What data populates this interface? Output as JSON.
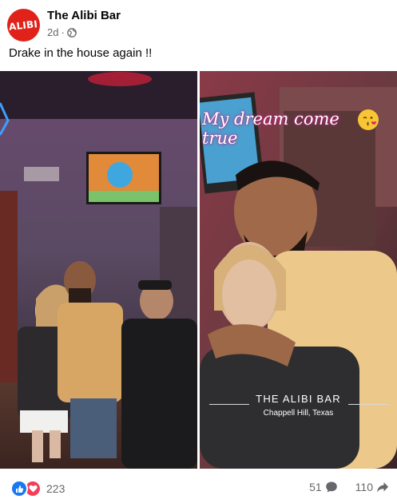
{
  "post": {
    "page_name": "The Alibi Bar",
    "avatar_text": "ALIBI",
    "time": "2d",
    "separator": "·",
    "caption": "Drake in the house again !!"
  },
  "photo_right": {
    "story_text": "My dream come true",
    "emoji": "kiss-emoji",
    "overlay_title": "THE ALIBI BAR",
    "overlay_subtitle": "Chappell Hill, Texas"
  },
  "footer": {
    "reaction_count": "223",
    "comment_count": "51",
    "share_count": "110"
  },
  "colors": {
    "brand_red": "#e0221b",
    "like_blue": "#1877f2",
    "love_red": "#f33e58",
    "meta_gray": "#65676b"
  }
}
